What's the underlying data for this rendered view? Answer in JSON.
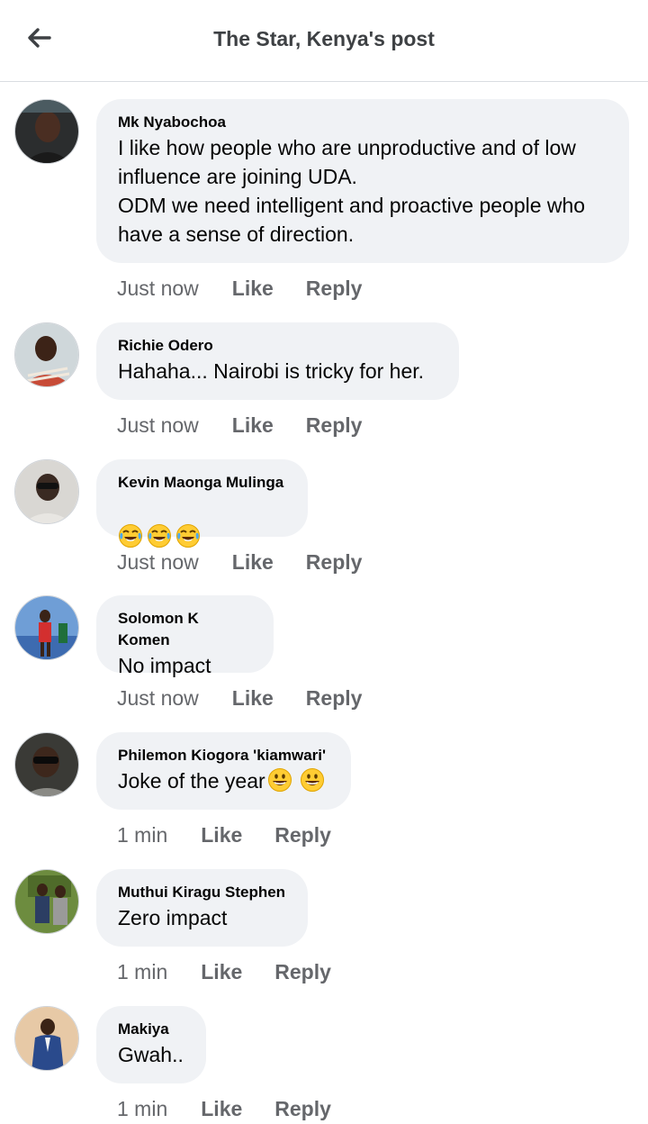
{
  "header": {
    "title": "The Star, Kenya's post",
    "back_icon": "arrow-left-icon"
  },
  "action_labels": {
    "like": "Like",
    "reply": "Reply"
  },
  "comments": [
    {
      "author": "Mk Nyabochoa",
      "text": "I like how people who are unproductive and of low\ninfluence are joining UDA.\nODM we need intelligent and proactive people who\nhave a sense of direction.",
      "time": "Just now"
    },
    {
      "author": "Richie Odero",
      "text": "Hahaha... Nairobi is tricky for her.",
      "time": "Just now"
    },
    {
      "author": "Kevin Maonga Mulinga",
      "text": "",
      "emojis": [
        "tears-of-joy",
        "tears-of-joy",
        "tears-of-joy"
      ],
      "time": "Just now"
    },
    {
      "author": "Solomon K Komen",
      "text": "No impact",
      "time": "Just now"
    },
    {
      "author": "Philemon Kiogora 'kiamwari'",
      "text": "Joke of the year",
      "emojis": [
        "grinning-face",
        "grinning-face"
      ],
      "time": "1 min"
    },
    {
      "author": "Muthui Kiragu Stephen",
      "text": "Zero impact",
      "time": "1 min"
    },
    {
      "author": "Makiya",
      "text": "Gwah..",
      "time": "1 min"
    }
  ]
}
